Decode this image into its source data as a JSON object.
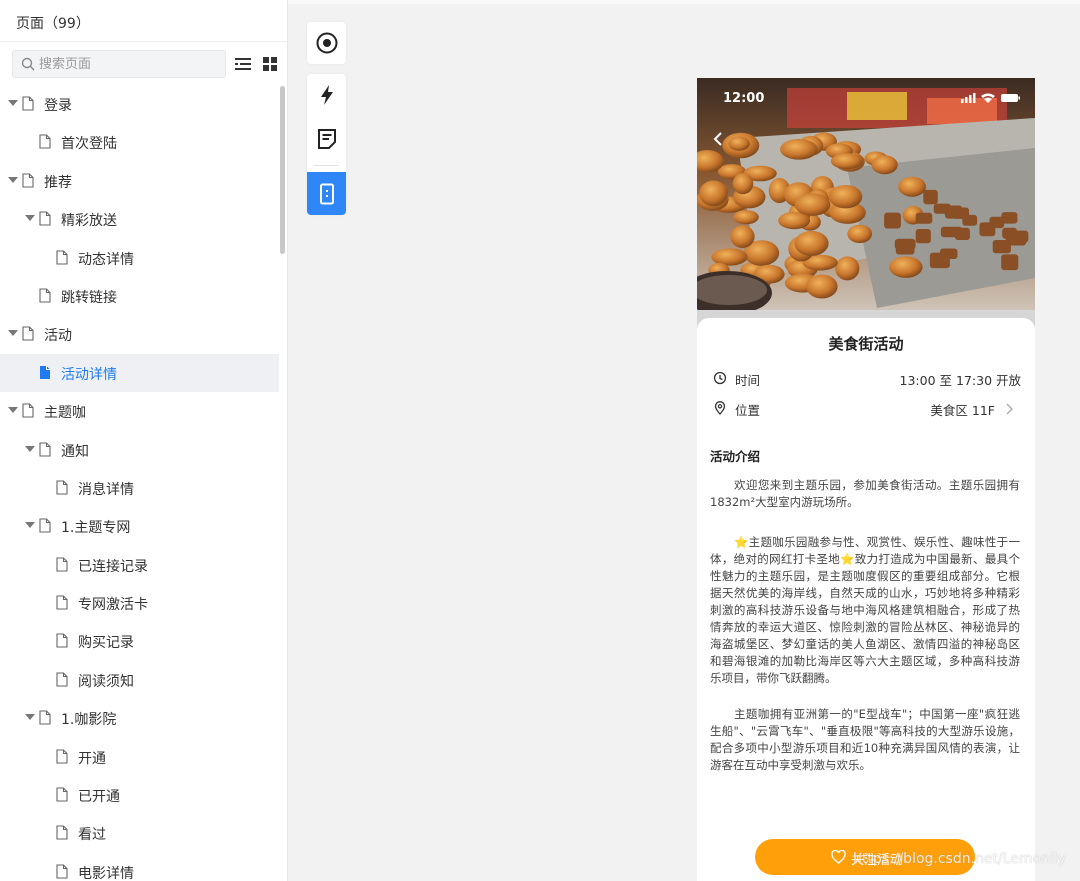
{
  "sidebar": {
    "title": "页面（99）",
    "search_placeholder": "搜索页面",
    "tree": [
      {
        "label": "登录",
        "depth": 0,
        "caret": true
      },
      {
        "label": "首次登陆",
        "depth": 1,
        "caret": false
      },
      {
        "label": "推荐",
        "depth": 0,
        "caret": true
      },
      {
        "label": "精彩放送",
        "depth": 1,
        "caret": true
      },
      {
        "label": "动态详情",
        "depth": 2,
        "caret": false
      },
      {
        "label": "跳转链接",
        "depth": 1,
        "caret": false
      },
      {
        "label": "活动",
        "depth": 0,
        "caret": true
      },
      {
        "label": "活动详情",
        "depth": 1,
        "caret": false,
        "selected": true
      },
      {
        "label": "主题咖",
        "depth": 0,
        "caret": true
      },
      {
        "label": "通知",
        "depth": 1,
        "caret": true
      },
      {
        "label": "消息详情",
        "depth": 2,
        "caret": false
      },
      {
        "label": "1.主题专网",
        "depth": 1,
        "caret": true
      },
      {
        "label": "已连接记录",
        "depth": 2,
        "caret": false
      },
      {
        "label": "专网激活卡",
        "depth": 2,
        "caret": false
      },
      {
        "label": "购买记录",
        "depth": 2,
        "caret": false
      },
      {
        "label": "阅读须知",
        "depth": 2,
        "caret": false
      },
      {
        "label": "1.咖影院",
        "depth": 1,
        "caret": true
      },
      {
        "label": "开通",
        "depth": 2,
        "caret": false
      },
      {
        "label": "已开通",
        "depth": 2,
        "caret": false
      },
      {
        "label": "看过",
        "depth": 2,
        "caret": false
      },
      {
        "label": "电影详情",
        "depth": 2,
        "caret": false
      }
    ]
  },
  "toolbar": {
    "icons": [
      "target-icon",
      "lightning-icon",
      "notes-icon",
      "device-icon"
    ],
    "active": "device-icon"
  },
  "phone": {
    "status_time": "12:00",
    "title": "美食街活动",
    "time_label": "时间",
    "time_value": "13:00 至 17:30 开放",
    "location_label": "位置",
    "location_value": "美食区 11F",
    "intro_title": "活动介绍",
    "para1": "欢迎您来到主题乐园，参加美食街活动。主题乐园拥有1832m²大型室内游玩场所。",
    "para2": "⭐主题咖乐园融参与性、观赏性、娱乐性、趣味性于一体，绝对的网红打卡圣地⭐致力打造成为中国最新、最具个性魅力的主题乐园，是主题咖度假区的重要组成部分。它根据天然优美的海岸线，自然天成的山水，巧妙地将多种精彩刺激的高科技游乐设备与地中海风格建筑相融合，形成了热情奔放的幸运大道区、惊险刺激的冒险丛林区、神秘诡异的海盗城堡区、梦幻童话的美人鱼湖区、激情四溢的神秘岛区和碧海银滩的加勒比海岸区等六大主题区域，多种高科技游乐项目，带你飞跃翻腾。",
    "para3": "主题咖拥有亚洲第一的\"E型战车\"；中国第一座\"疯狂逃生船\"、\"云霄飞车\"、\"垂直极限\"等高科技的大型游乐设施，配合多项中小型游乐项目和近10种充满异国风情的表演，让游客在互动中享受刺激与欢乐。",
    "follow_label": "关注活动"
  },
  "colors": {
    "accent": "#1f7cf0",
    "button": "#ff9f0a"
  },
  "watermark": "https://blog.csdn.net/Lemonlly"
}
